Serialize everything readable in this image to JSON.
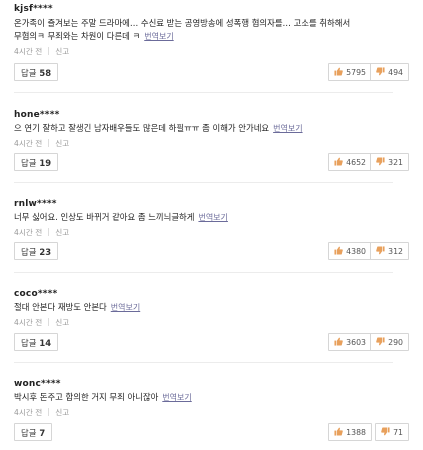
{
  "comments": [
    {
      "user": "kjsf****",
      "text": "온가족이 즐겨보는 주말 드라마에… 수신료 받는 공영방송에 성폭행 혐의자를… 고소를 취하해서 무혐의ㅋ 무죄와는 차원이 다른데 ㅋ",
      "translate": "번역보기",
      "time": "4시간 전",
      "report": "신고",
      "reply_label": "답글",
      "reply_count": "58",
      "likes": "5795",
      "dislikes": "494"
    },
    {
      "user": "hone****",
      "text": "으 연기 잘하고 잘생긴 남자배우들도 많은데 하필ㅠㅠ 좀 이해가 안가네요",
      "translate": "번역보기",
      "time": "4시간 전",
      "report": "신고",
      "reply_label": "답글",
      "reply_count": "19",
      "likes": "4652",
      "dislikes": "321"
    },
    {
      "user": "rnlw****",
      "text": "너무 싫어요. 인상도 바뀌거 같아요 좀 느끼늬글하게",
      "translate": "번역보기",
      "time": "4시간 전",
      "report": "신고",
      "reply_label": "답글",
      "reply_count": "23",
      "likes": "4380",
      "dislikes": "312"
    },
    {
      "user": "coco****",
      "text": "절대 안본다 재방도 안본다",
      "translate": "번역보기",
      "time": "4시간 전",
      "report": "신고",
      "reply_label": "답글",
      "reply_count": "14",
      "likes": "3603",
      "dislikes": "290"
    },
    {
      "user": "wonc****",
      "text": "박시후 돈주고 합의한 거지 무죄 아니잖아",
      "translate": "번역보기",
      "time": "4시간 전",
      "report": "신고",
      "reply_label": "답글",
      "reply_count": "7",
      "likes": "1388",
      "dislikes": "71"
    }
  ],
  "colors": {
    "like": "#e8a05c",
    "dislike": "#e8a05c"
  },
  "icons": {
    "like": "thumbs-up-icon",
    "dislike": "thumbs-down-icon"
  }
}
